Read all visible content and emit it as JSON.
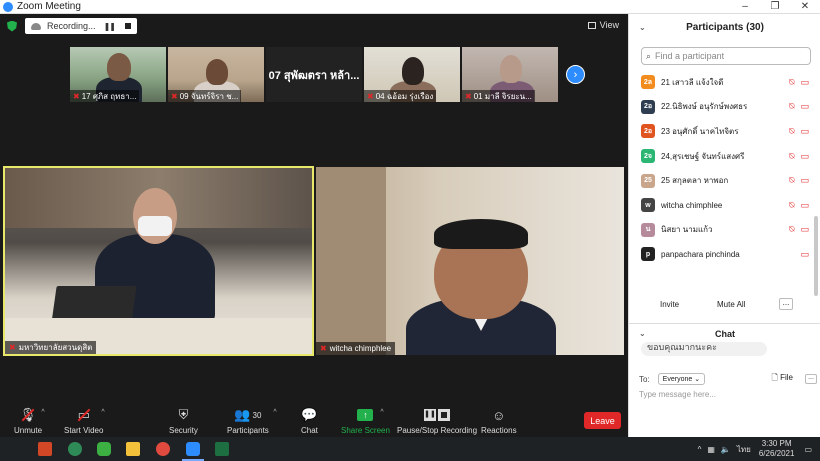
{
  "window": {
    "title": "Zoom Meeting",
    "controls": [
      "–",
      "❐",
      "✕"
    ]
  },
  "recording": {
    "label": "Recording...",
    "pause": "❚❚"
  },
  "view_button": {
    "label": "View"
  },
  "thumbnails": [
    {
      "name": "17 ศุภิส ฤทธา..."
    },
    {
      "name": "09 จันทร์จิรา ช..."
    },
    {
      "name": "07 สุพัฒตรา หล้า..."
    },
    {
      "name": "04 ฉอ้อม รุ่งเรือง"
    },
    {
      "name": "01 มาลี จิรยะน..."
    }
  ],
  "main_videos": [
    {
      "name": "มหาวิทยาลัยสวนดุสิต"
    },
    {
      "name": "witcha chimphlee"
    }
  ],
  "toolbar": {
    "unmute": "Unmute",
    "start_video": "Start Video",
    "security": "Security",
    "participants": "Participants",
    "participants_count": "30",
    "chat": "Chat",
    "share_screen": "Share Screen",
    "pause_stop_recording": "Pause/Stop Recording",
    "reactions": "Reactions",
    "leave": "Leave"
  },
  "participants_panel": {
    "title": "Participants (30)",
    "search_placeholder": "Find a participant",
    "items": [
      {
        "avatar": "2ล",
        "color": "#f28c1e",
        "name": "21 เสาวลี แจ้งใจดี",
        "cam_off": true
      },
      {
        "avatar": "2อ",
        "color": "#2e3d4f",
        "name": "22.นิธิพงษ์ อนุรักษ์พงศธร",
        "cam_off": true
      },
      {
        "avatar": "2อ",
        "color": "#e0541f",
        "name": "23 อนุศักดิ์ นาคไทจิตร",
        "cam_off": true
      },
      {
        "avatar": "2จ",
        "color": "#2bb673",
        "name": "24,สุรเชษฐ์ จันทร์แสงศรี",
        "cam_off": true
      },
      {
        "avatar": "25",
        "color": "#c9a58c",
        "name": "25 สกุลตลา หาพอก",
        "cam_off": true
      },
      {
        "avatar": "w",
        "color": "#444444",
        "name": "witcha chimphlee",
        "cam_off": true
      },
      {
        "avatar": "น",
        "color": "#b58a9a",
        "name": "นิสยา นามแก้ว",
        "cam_off": true
      },
      {
        "avatar": "p",
        "color": "#222222",
        "name": "panpachara pinchinda",
        "cam_off": true
      }
    ],
    "invite": "Invite",
    "mute_all": "Mute All",
    "more": "..."
  },
  "chat_panel": {
    "title": "Chat",
    "last_message": "ขอบคุณมากนะคะ",
    "to_label": "To:",
    "recipient": "Everyone",
    "file_label": "File",
    "input_placeholder": "Type message here..."
  },
  "taskbar": {
    "time": "3:30 PM",
    "date": "6/26/2021",
    "language": "ไทย"
  },
  "colors": {
    "accent": "#2d8cff",
    "leave": "#e02828",
    "share": "#22b14c",
    "active_speaker_border": "#e8e86a"
  }
}
